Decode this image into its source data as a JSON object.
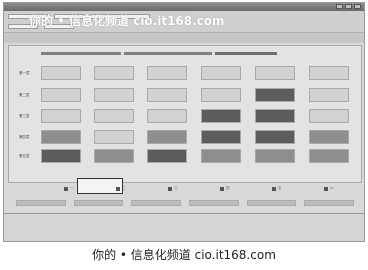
{
  "watermark": "你的 • 信息化频道 cio.it168.com",
  "caption": "你的 • 信息化频道 cio.it168.com",
  "window": {
    "title": ""
  },
  "panel": {
    "header": ""
  },
  "legend": [
    {
      "label": "一"
    },
    {
      "label": "二"
    },
    {
      "label": "三"
    },
    {
      "label": "四"
    },
    {
      "label": "五"
    },
    {
      "label": "六"
    }
  ],
  "grid": {
    "row_labels": [
      "第一层",
      "第二层",
      "第三层",
      "第四层",
      "第五层"
    ],
    "rows": [
      [
        "light",
        "light",
        "light",
        "light",
        "light",
        "light"
      ],
      [
        "light",
        "light",
        "light",
        "light",
        "dark",
        "light"
      ],
      [
        "light",
        "light",
        "light",
        "dark",
        "dark",
        "light"
      ],
      [
        "med",
        "light",
        "med",
        "dark",
        "dark",
        "med"
      ],
      [
        "dark",
        "med",
        "dark",
        "med",
        "med",
        "med"
      ]
    ],
    "cell_text": {
      "r2c0": ""
    }
  },
  "footer": {
    "col1": "",
    "col2": "",
    "col3": ""
  }
}
